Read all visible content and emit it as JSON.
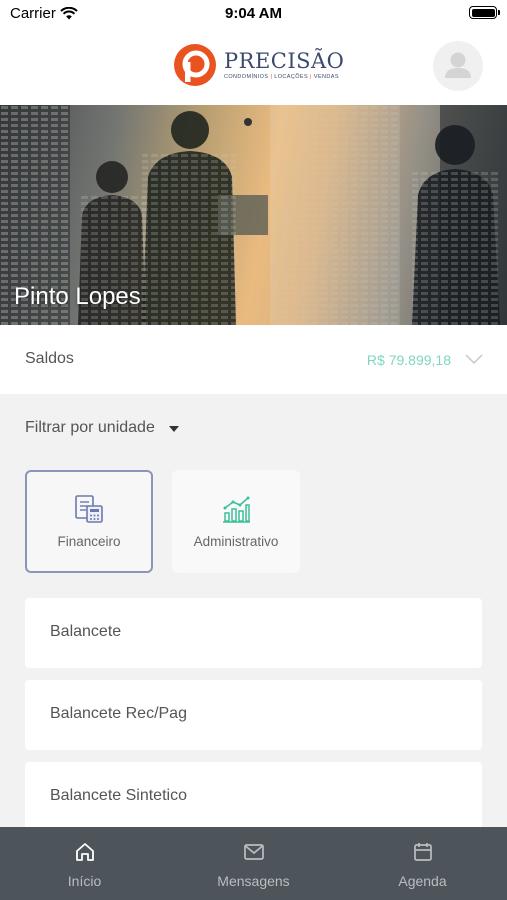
{
  "status_bar": {
    "carrier": "Carrier",
    "time": "9:04 AM",
    "battery_level": 1.0
  },
  "header": {
    "logo_name": "PRECISÃO",
    "logo_tagline": [
      "CONDOMÍNIOS",
      "LOCAÇÕES",
      "VENDAS"
    ],
    "brand_color": "#e8531f",
    "brand_text_color": "#3c4a6b"
  },
  "hero": {
    "title": "Pinto Lopes"
  },
  "saldos": {
    "label": "Saldos",
    "value": "R$ 79.899,18",
    "value_color": "#7fd6c0"
  },
  "filter": {
    "label": "Filtrar por unidade"
  },
  "categories": [
    {
      "label": "Financeiro",
      "icon": "calculator-document-icon",
      "selected": true,
      "icon_color": "#6b78b0"
    },
    {
      "label": "Administrativo",
      "icon": "bar-chart-trend-icon",
      "selected": false,
      "icon_color": "#3cbf9a"
    }
  ],
  "reports": [
    {
      "label": "Balancete"
    },
    {
      "label": "Balancete Rec/Pag"
    },
    {
      "label": "Balancete Sintetico"
    }
  ],
  "tab_bar": {
    "background": "#4d545a",
    "tabs": [
      {
        "label": "Início",
        "icon": "home-icon"
      },
      {
        "label": "Mensagens",
        "icon": "mail-icon"
      },
      {
        "label": "Agenda",
        "icon": "calendar-icon"
      }
    ]
  }
}
